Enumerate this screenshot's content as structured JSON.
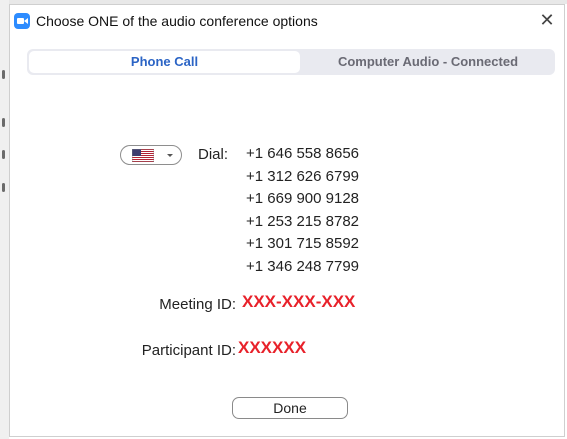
{
  "window": {
    "title": "Choose ONE of the audio conference options",
    "close_icon": "close-icon",
    "app_icon": "zoom-camera-icon"
  },
  "tabs": [
    {
      "label": "Phone Call",
      "active": true
    },
    {
      "label": "Computer Audio - Connected",
      "active": false
    }
  ],
  "dial": {
    "country_icon": "us-flag-icon",
    "label": "Dial:",
    "numbers": [
      "+1 646 558 8656",
      "+1 312 626 6799",
      "+1 669 900 9128",
      "+1 253 215 8782",
      "+1 301 715 8592",
      "+1 346 248 7799"
    ]
  },
  "meeting": {
    "label": "Meeting ID:",
    "value": "XXX-XXX-XXX"
  },
  "participant": {
    "label": "Participant ID:",
    "value": "XXXXXX"
  },
  "done_label": "Done",
  "colors": {
    "accent": "#2d8cff",
    "active_tab_text": "#2b64c5",
    "id_red": "#e8212a"
  }
}
